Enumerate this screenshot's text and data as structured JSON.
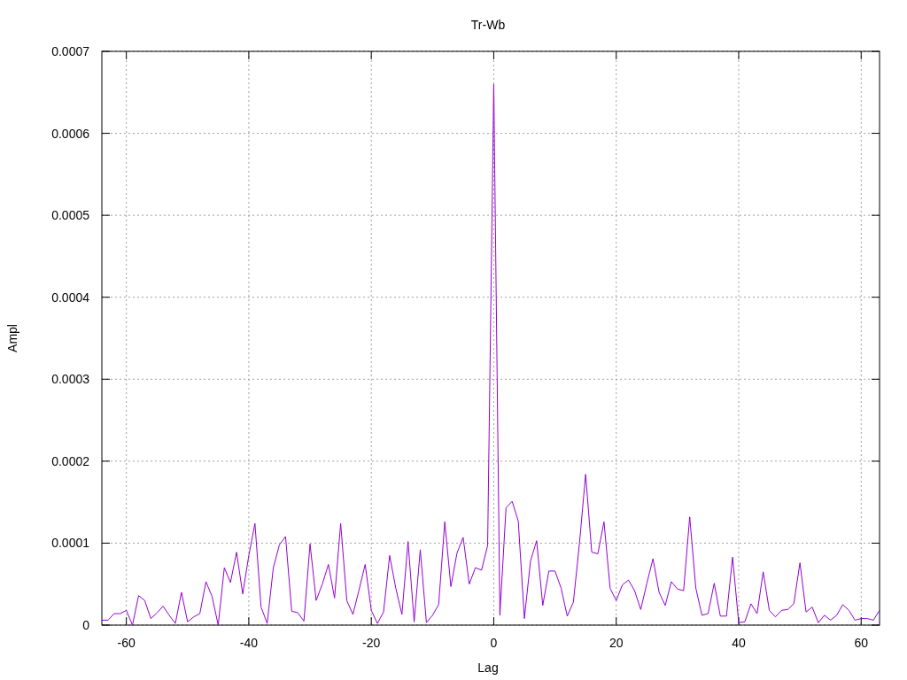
{
  "chart": {
    "chart_data": {
      "type": "line",
      "title": "Tr-Wb",
      "xlabel": "Lag",
      "ylabel": "Ampl",
      "x": [
        -64,
        -63,
        -62,
        -61,
        -60,
        -59,
        -58,
        -57,
        -56,
        -55,
        -54,
        -53,
        -52,
        -51,
        -50,
        -49,
        -48,
        -47,
        -46,
        -45,
        -44,
        -43,
        -42,
        -41,
        -40,
        -39,
        -38,
        -37,
        -36,
        -35,
        -34,
        -33,
        -32,
        -31,
        -30,
        -29,
        -28,
        -27,
        -26,
        -25,
        -24,
        -23,
        -22,
        -21,
        -20,
        -19,
        -18,
        -17,
        -16,
        -15,
        -14,
        -13,
        -12,
        -11,
        -10,
        -9,
        -8,
        -7,
        -6,
        -5,
        -4,
        -3,
        -2,
        -1,
        0,
        1,
        2,
        3,
        4,
        5,
        6,
        7,
        8,
        9,
        10,
        11,
        12,
        13,
        14,
        15,
        16,
        17,
        18,
        19,
        20,
        21,
        22,
        23,
        24,
        25,
        26,
        27,
        28,
        29,
        30,
        31,
        32,
        33,
        34,
        35,
        36,
        37,
        38,
        39,
        40,
        41,
        42,
        43,
        44,
        45,
        46,
        47,
        48,
        49,
        50,
        51,
        52,
        53,
        54,
        55,
        56,
        57,
        58,
        59,
        60,
        61,
        62,
        63
      ],
      "grid": true,
      "series": [
        {
          "color": "#9400d3",
          "values": [
            6e-06,
            6e-06,
            1.4e-05,
            1.4e-05,
            1.8e-05,
            0,
            3.6e-05,
            3e-05,
            8e-06,
            1.5e-05,
            2.3e-05,
            1.2e-05,
            2e-06,
            4e-05,
            4e-06,
            1e-05,
            1.4e-05,
            5.3e-05,
            3.5e-05,
            0,
            7e-05,
            5.2e-05,
            8.9e-05,
            3.8e-05,
            8.5e-05,
            0.000124,
            2.2e-05,
            2e-06,
            7e-05,
            9.8e-05,
            0.000108,
            1.7e-05,
            1.5e-05,
            5e-06,
            9.9e-05,
            3e-05,
            5e-05,
            7.4e-05,
            3.3e-05,
            0.000124,
            3e-05,
            1.3e-05,
            4.3e-05,
            7.4e-05,
            1.8e-05,
            2e-06,
            1.6e-05,
            8.5e-05,
            4.5e-05,
            1.3e-05,
            0.000102,
            4e-06,
            9.2e-05,
            3e-06,
            1.2e-05,
            2.5e-05,
            0.000126,
            4.7e-05,
            8.8e-05,
            0.000107,
            5e-05,
            7e-05,
            6.7e-05,
            9.7e-05,
            0.00066,
            1.2e-05,
            0.000143,
            0.000151,
            0.000127,
            8e-06,
            7.8e-05,
            0.000103,
            2.4e-05,
            6.6e-05,
            6.6e-05,
            4.5e-05,
            1.1e-05,
            2.8e-05,
            0.0001,
            0.000184,
            8.9e-05,
            8.7e-05,
            0.000126,
            4.5e-05,
            3e-05,
            4.9e-05,
            5.5e-05,
            4.2e-05,
            1.9e-05,
            5.1e-05,
            8.1e-05,
            4e-05,
            2.4e-05,
            5.3e-05,
            4.4e-05,
            4.2e-05,
            0.000132,
            4.5e-05,
            1.2e-05,
            1.4e-05,
            5.1e-05,
            1.1e-05,
            1.1e-05,
            8.3e-05,
            3e-06,
            4e-06,
            2.6e-05,
            1.4e-05,
            6.5e-05,
            1.8e-05,
            1e-05,
            1.8e-05,
            1.9e-05,
            2.6e-05,
            7.6e-05,
            1.6e-05,
            2.2e-05,
            3e-06,
            1.2e-05,
            6e-06,
            1.2e-05,
            2.5e-05,
            1.8e-05,
            6e-06,
            8e-06,
            8e-06,
            6e-06,
            1.8e-05
          ]
        }
      ],
      "xlim": [
        -64,
        63
      ],
      "ylim": [
        0,
        0.0007
      ],
      "xticks": [
        -60,
        -40,
        -20,
        0,
        20,
        40,
        60
      ],
      "yticks": [
        0,
        0.0001,
        0.0002,
        0.0003,
        0.0004,
        0.0005,
        0.0006,
        0.0007
      ]
    }
  }
}
